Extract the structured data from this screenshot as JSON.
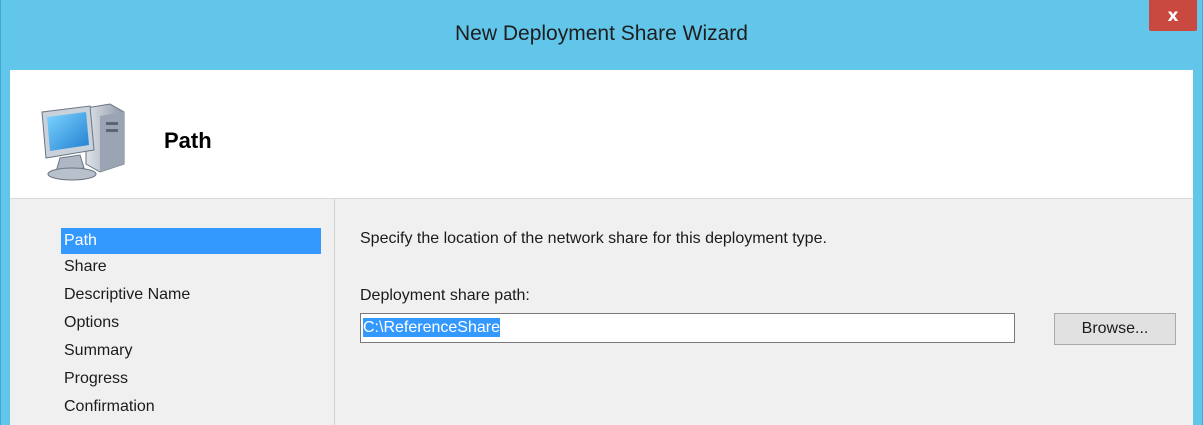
{
  "window": {
    "title": "New Deployment Share Wizard",
    "close_glyph": "x",
    "icons": {
      "close": "close-icon",
      "header": "computer-icon"
    }
  },
  "header": {
    "title": "Path"
  },
  "nav": {
    "items": [
      {
        "label": "Path",
        "selected": true
      },
      {
        "label": "Share",
        "selected": false
      },
      {
        "label": "Descriptive Name",
        "selected": false
      },
      {
        "label": "Options",
        "selected": false
      },
      {
        "label": "Summary",
        "selected": false
      },
      {
        "label": "Progress",
        "selected": false
      },
      {
        "label": "Confirmation",
        "selected": false
      }
    ]
  },
  "content": {
    "description": "Specify the location of the network share for this deployment type.",
    "path_label": "Deployment share path:",
    "path_value": "C:\\ReferenceShare",
    "browse_label": "Browse..."
  },
  "colors": {
    "titlebar": "#62c5ea",
    "close_button": "#c9483f",
    "selection": "#3399ff",
    "panel": "#f0f0f0"
  }
}
